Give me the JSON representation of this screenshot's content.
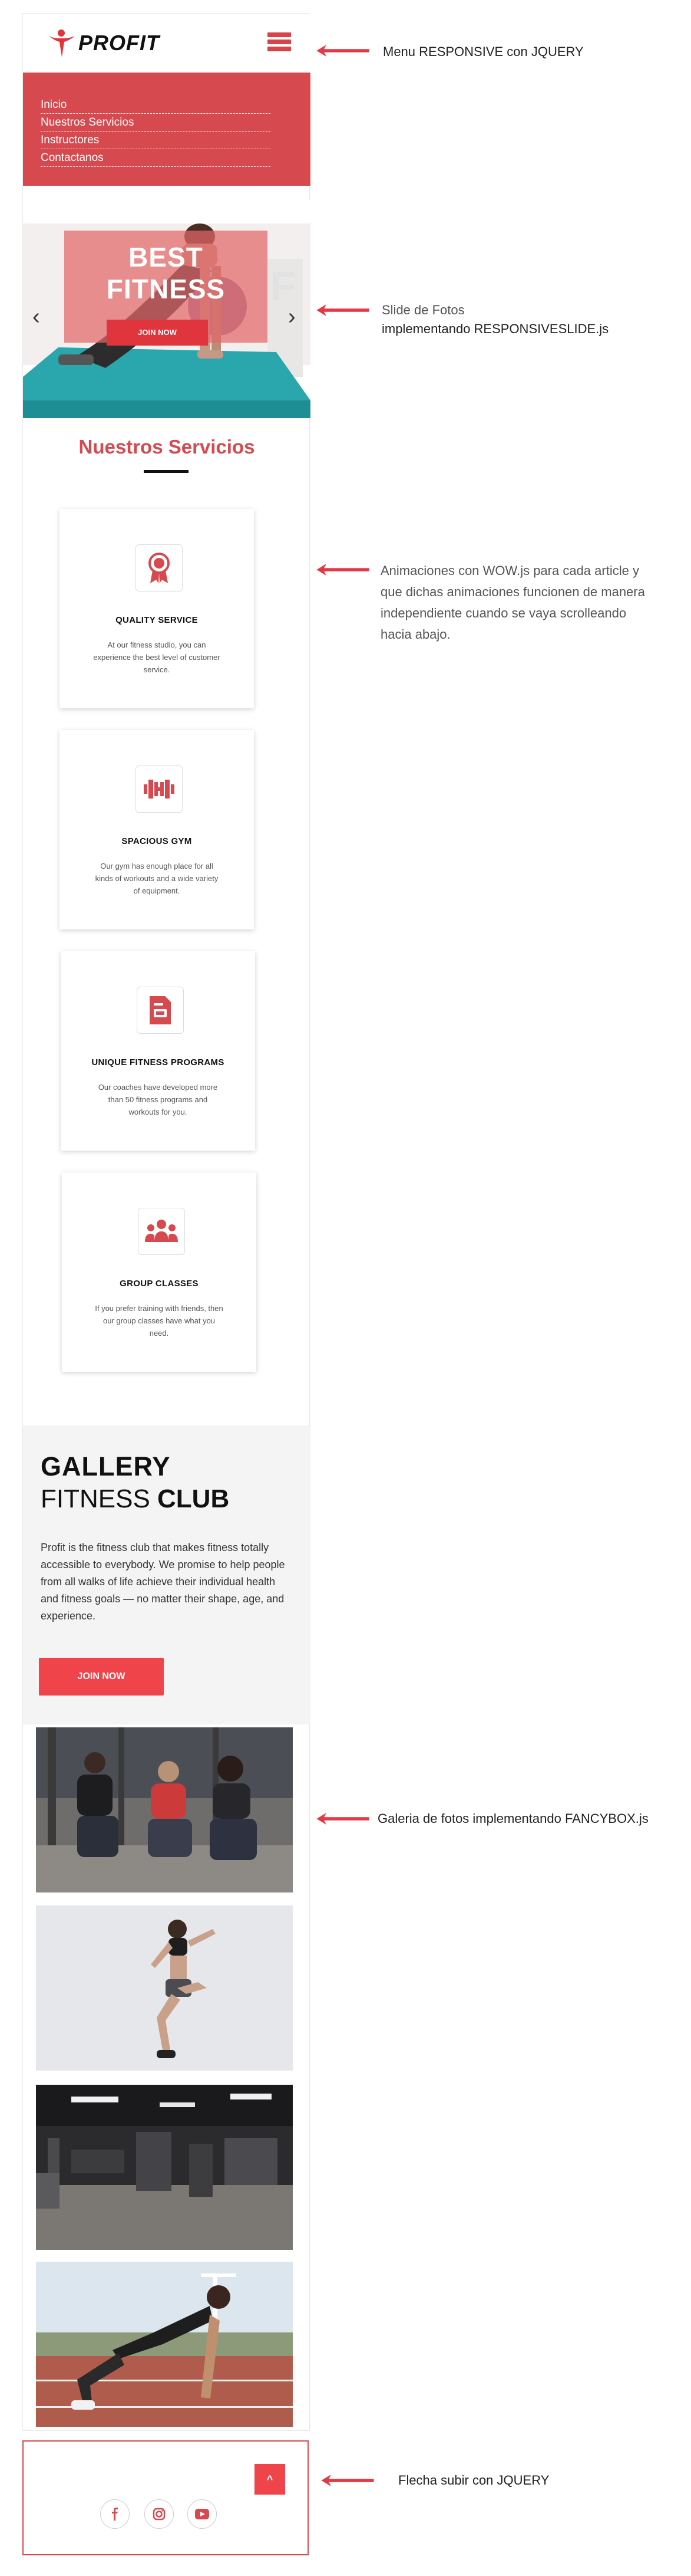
{
  "header": {
    "logo_text": "PROFIT"
  },
  "menu": {
    "items": [
      "Inicio",
      "Nuestros Servicios",
      "Instructores",
      "Contactanos"
    ]
  },
  "slider": {
    "title_line1": "BEST",
    "title_line2": "FITNESS",
    "button": "JOIN NOW",
    "prev": "‹",
    "next": "›"
  },
  "services": {
    "title": "Nuestros Servicios",
    "cards": [
      {
        "title": "QUALITY SERVICE",
        "text": "At our fitness studio, you can experience the best level of customer service.",
        "icon": "award-icon"
      },
      {
        "title": "SPACIOUS GYM",
        "text": "Our gym has enough place for all kinds of workouts and a wide variety of equipment.",
        "icon": "dumbbell-icon"
      },
      {
        "title": "UNIQUE FITNESS PROGRAMS",
        "text": "Our coaches have developed more than 50 fitness programs and workouts for you.",
        "icon": "document-icon"
      },
      {
        "title": "GROUP CLASSES",
        "text": "If you prefer training with friends, then our group classes have what you need.",
        "icon": "group-icon"
      }
    ]
  },
  "gallery": {
    "heading": "GALLERY",
    "sub_light": "FITNESS",
    "sub_bold": "CLUB",
    "paragraph": "Profit is the fitness club that makes fitness totally accessible to everybody. We promise to help people from all walks of life achieve their individual health and fitness goals — no matter their shape, age, and experience.",
    "button": "JOIN NOW"
  },
  "footer": {
    "social": [
      "facebook-icon",
      "instagram-icon",
      "youtube-icon"
    ],
    "to_top": "^"
  },
  "annotations": {
    "menu": "Menu RESPONSIVE con JQUERY",
    "slide_line1": "Slide de Fotos",
    "slide_line2": "implementando RESPONSIVESLIDE.js",
    "wow_line1": "Animaciones con WOW.js para cada article y",
    "wow_line2": "que dichas animaciones funcionen de manera",
    "wow_line3": "independiente cuando se vaya scrolleando",
    "wow_line4": "hacia abajo.",
    "gallery": "Galeria de fotos implementando FANCYBOX.js",
    "arrow_up": "Flecha subir con JQUERY"
  },
  "colors": {
    "brand_red": "#d6494e",
    "button_red": "#ef444a",
    "annotation_arrow": "#e23a44"
  }
}
